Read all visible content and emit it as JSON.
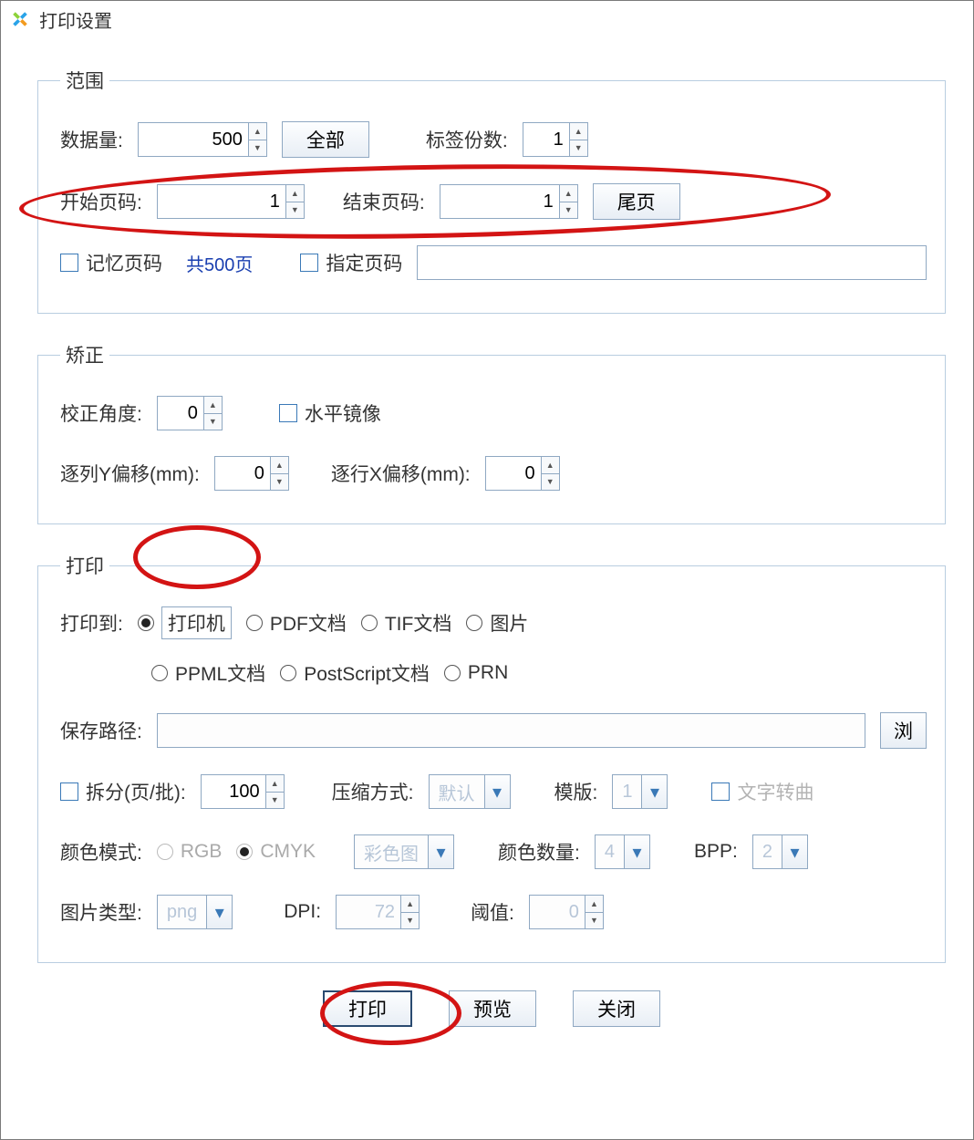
{
  "window": {
    "title": "打印设置"
  },
  "range": {
    "legend": "范围",
    "data_count_label": "数据量:",
    "data_count_value": "500",
    "all_button": "全部",
    "label_copies_label": "标签份数:",
    "label_copies_value": "1",
    "start_page_label": "开始页码:",
    "start_page_value": "1",
    "end_page_label": "结束页码:",
    "end_page_value": "1",
    "last_page_button": "尾页",
    "remember_page_label": "记忆页码",
    "total_pages_text": "共500页",
    "specify_page_label": "指定页码",
    "specify_page_value": ""
  },
  "correct": {
    "legend": "矫正",
    "angle_label": "校正角度:",
    "angle_value": "0",
    "mirror_label": "水平镜像",
    "y_offset_label": "逐列Y偏移(mm):",
    "y_offset_value": "0",
    "x_offset_label": "逐行X偏移(mm):",
    "x_offset_value": "0"
  },
  "print": {
    "legend": "打印",
    "target_label": "打印到:",
    "opt_printer": "打印机",
    "opt_pdf": "PDF文档",
    "opt_tif": "TIF文档",
    "opt_image": "图片",
    "opt_ppml": "PPML文档",
    "opt_ps": "PostScript文档",
    "opt_prn": "PRN",
    "save_path_label": "保存路径:",
    "save_path_value": "",
    "browse_button": "浏",
    "split_label": "拆分(页/批):",
    "split_value": "100",
    "compress_label": "压缩方式:",
    "compress_value": "默认",
    "template_label": "模版:",
    "template_value": "1",
    "text_rotate_label": "文字转曲",
    "color_mode_label": "颜色模式:",
    "opt_rgb": "RGB",
    "opt_cmyk": "CMYK",
    "color_img_value": "彩色图",
    "color_count_label": "颜色数量:",
    "color_count_value": "4",
    "bpp_label": "BPP:",
    "bpp_value": "2",
    "image_type_label": "图片类型:",
    "image_type_value": "png",
    "dpi_label": "DPI:",
    "dpi_value": "72",
    "threshold_label": "阈值:",
    "threshold_value": "0"
  },
  "footer": {
    "print_button": "打印",
    "preview_button": "预览",
    "close_button": "关闭"
  }
}
